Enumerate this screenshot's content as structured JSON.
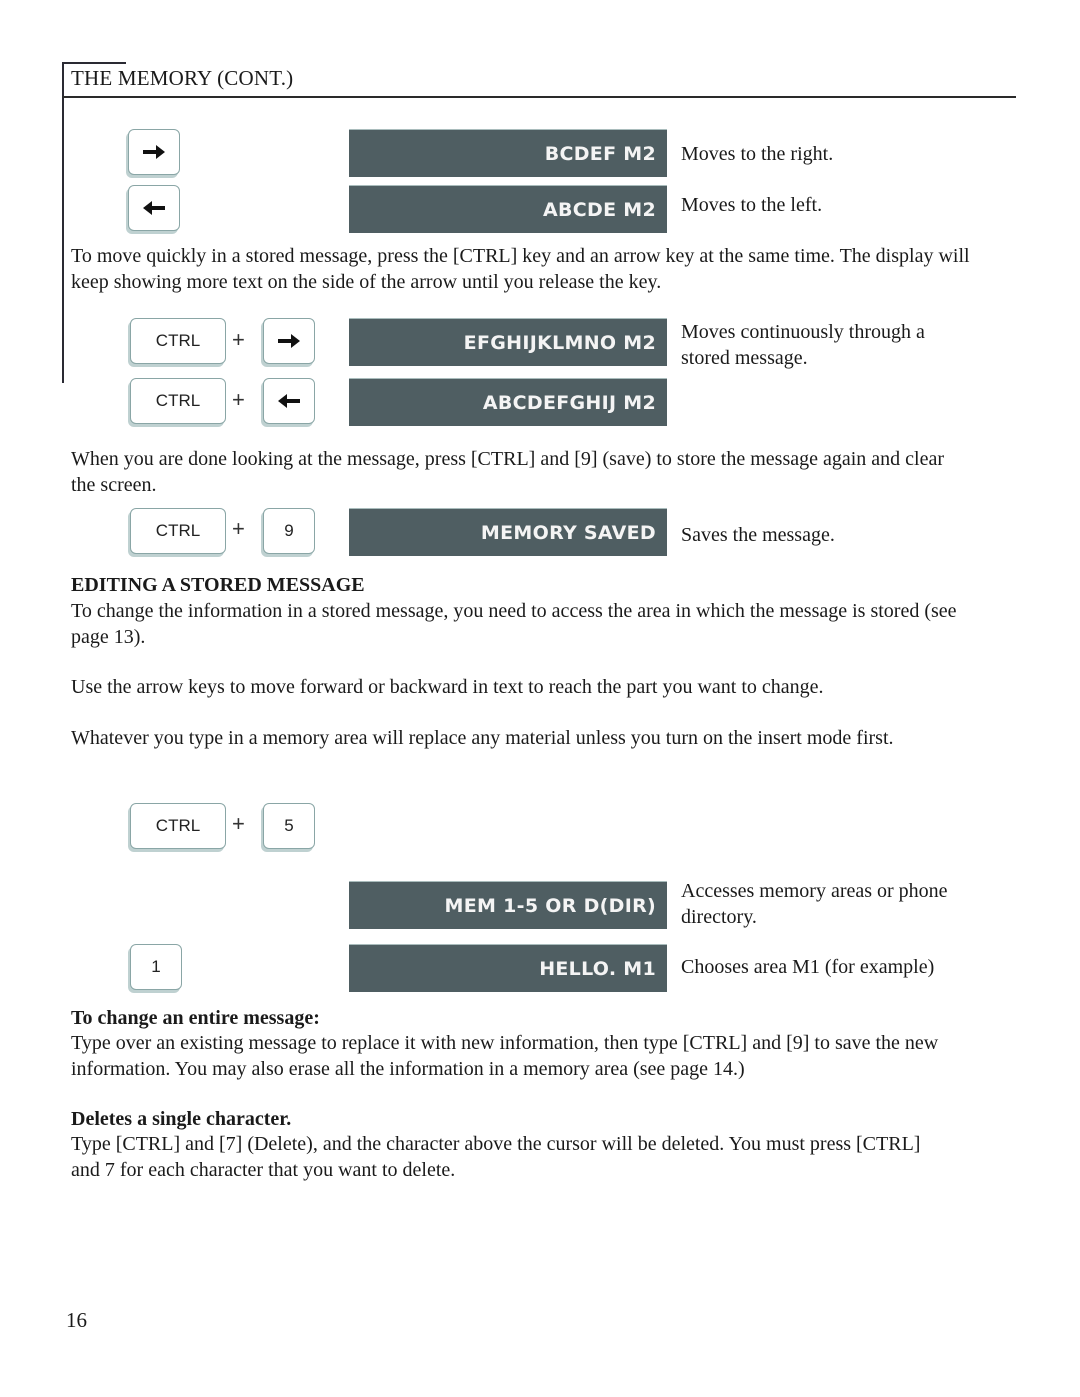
{
  "header": {
    "title": "THE MEMORY (CONT.)"
  },
  "colors": {
    "display_bg": "#4f5e62",
    "display_text": "#f4f4f4",
    "key_border": "#8aa6a6"
  },
  "rows_arrow": [
    {
      "key_icon": "right-arrow-icon",
      "display": "BCDEF M2",
      "desc": "Moves to the right."
    },
    {
      "key_icon": "left-arrow-icon",
      "display": "ABCDE M2",
      "desc": "Moves to the left."
    }
  ],
  "para_ctrl_arrow": "To move quickly in a stored message, press the [CTRL] key and an arrow key at the same time. The display will keep showing more text on the side of the arrow until you release the key.",
  "rows_ctrl_arrow": [
    {
      "key1": "CTRL",
      "plus": "+",
      "key2_icon": "right-arrow-icon",
      "display": "EFGHIJKLMNO M2",
      "desc": "Moves continuously through a stored message."
    },
    {
      "key1": "CTRL",
      "plus": "+",
      "key2_icon": "left-arrow-icon",
      "display": "ABCDEFGHIJ M2",
      "desc": ""
    }
  ],
  "para_save": "When you are done looking at the message, press [CTRL] and [9] (save) to store the message again and clear the screen.",
  "row_save": {
    "key1": "CTRL",
    "plus": "+",
    "key2": "9",
    "display": "MEMORY SAVED",
    "desc": "Saves the message."
  },
  "editing": {
    "heading": "EDITING A STORED MESSAGE",
    "para1": "To change the information in a stored message, you need to access the area in which the message is stored (see page 13).",
    "para2": "Use the arrow keys to move forward or backward in text to reach the part you want to change.",
    "para3": "Whatever you type in a memory area will replace any material unless you turn on the insert mode first."
  },
  "row_ctrl5": {
    "key1": "CTRL",
    "plus": "+",
    "key2": "5"
  },
  "row_mem": {
    "display": "MEM 1-5 OR D(DIR)",
    "desc": "Accesses memory areas or phone directory."
  },
  "row_one": {
    "key": "1",
    "display": "HELLO. M1",
    "desc": "Chooses area M1 (for example)"
  },
  "change_entire": {
    "heading": "To change an entire message:",
    "text": "Type over an existing message to replace it with new information, then type [CTRL] and [9] to save the new information. You may also erase all the information in a memory area (see page 14.)"
  },
  "delete_single": {
    "heading": "Deletes a single character.",
    "text": "Type [CTRL] and [7] (Delete), and the character above the cursor will be deleted. You must press [CTRL] and 7 for each character that you want to delete."
  },
  "page_number": "16"
}
